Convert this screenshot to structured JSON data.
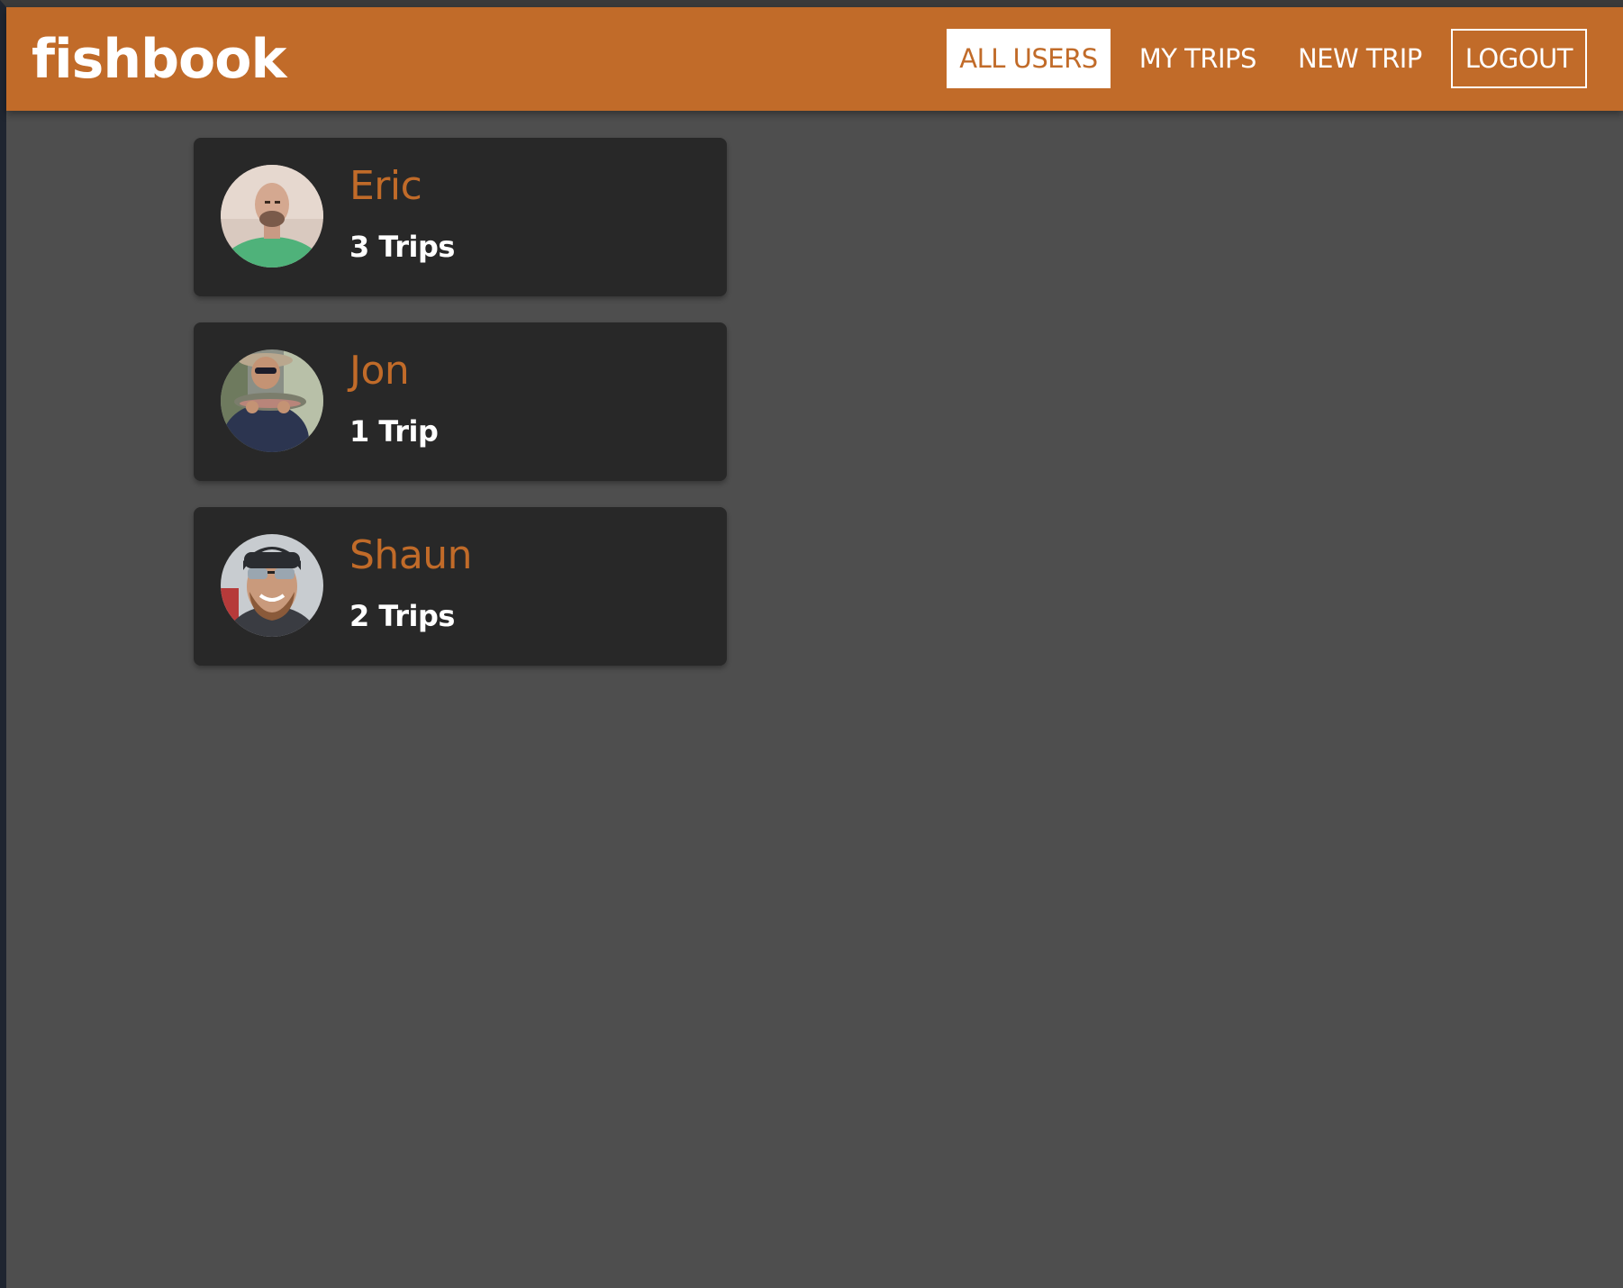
{
  "app": {
    "brand": "fishbook"
  },
  "nav": {
    "items": [
      {
        "label": "ALL USERS",
        "active": true
      },
      {
        "label": "MY TRIPS",
        "active": false
      },
      {
        "label": "NEW TRIP",
        "active": false
      },
      {
        "label": "LOGOUT",
        "active": false
      }
    ]
  },
  "users": [
    {
      "name": "Eric",
      "trips": "3 Trips",
      "avatar": "avatar-photo-eric"
    },
    {
      "name": "Jon",
      "trips": "1 Trip",
      "avatar": "avatar-photo-jon"
    },
    {
      "name": "Shaun",
      "trips": "2 Trips",
      "avatar": "avatar-photo-shaun"
    }
  ],
  "colors": {
    "accent": "#c16b29",
    "background": "#4e4e4e",
    "card": "#282828",
    "text": "#ffffff"
  }
}
